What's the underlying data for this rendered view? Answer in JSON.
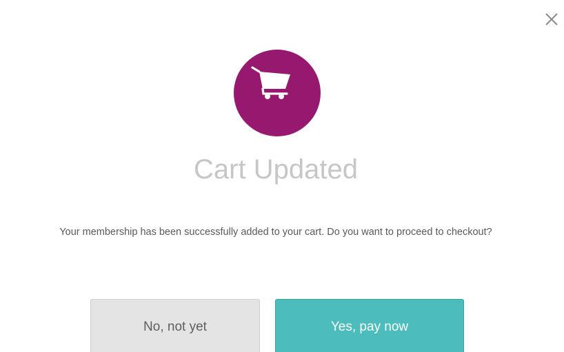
{
  "dialog": {
    "title": "Cart Updated",
    "message": "Your membership has been successfully added to your cart. Do you want to proceed to checkout?",
    "icon": "shopping-cart-icon",
    "close_icon": "close-icon",
    "decline_label": "No, not yet",
    "confirm_label": "Yes, pay now"
  },
  "colors": {
    "accent": "#97186f",
    "confirm_button": "#4cbdbc",
    "decline_button": "#e4e4e4",
    "title_text": "#c6c6c6"
  }
}
